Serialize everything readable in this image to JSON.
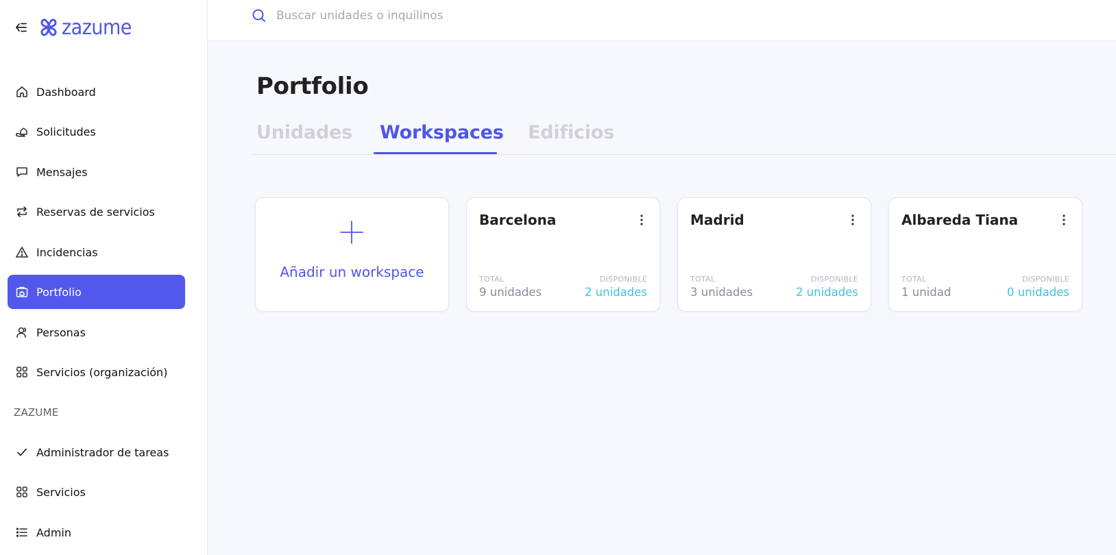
{
  "app": {
    "brand_name": "zazume",
    "brand_color": "#4f56e8",
    "accent_cyan": "#3ec3dd"
  },
  "search": {
    "placeholder": "Buscar unidades o inquilinos",
    "value": ""
  },
  "sidebar": {
    "items": [
      {
        "label": "Dashboard",
        "icon": "home-icon"
      },
      {
        "label": "Solicitudes",
        "icon": "hand-house-icon"
      },
      {
        "label": "Mensajes",
        "icon": "message-icon"
      },
      {
        "label": "Reservas de servicios",
        "icon": "repeat-icon"
      },
      {
        "label": "Incidencias",
        "icon": "warning-icon"
      },
      {
        "label": "Portfolio",
        "icon": "portfolio-icon",
        "active": true
      },
      {
        "label": "Personas",
        "icon": "people-icon"
      },
      {
        "label": "Servicios (organización)",
        "icon": "grid-icon"
      }
    ],
    "section_label": "ZAZUME",
    "section_items": [
      {
        "label": "Administrador de tareas",
        "icon": "check-icon"
      },
      {
        "label": "Servicios",
        "icon": "grid-icon"
      },
      {
        "label": "Admin",
        "icon": "list-icon"
      }
    ]
  },
  "main": {
    "title": "Portfolio",
    "tabs": [
      {
        "label": "Unidades",
        "active": false
      },
      {
        "label": "Workspaces",
        "active": true
      },
      {
        "label": "Edificios",
        "active": false
      }
    ],
    "add_card_label": "Añadir un workspace",
    "workspaces": [
      {
        "name": "Barcelona",
        "total_label": "TOTAL",
        "total_value": "9 unidades",
        "available_label": "DISPONIBLE",
        "available_value": "2 unidades"
      },
      {
        "name": "Madrid",
        "total_label": "TOTAL",
        "total_value": "3 unidades",
        "available_label": "DISPONIBLE",
        "available_value": "2 unidades"
      },
      {
        "name": "Albareda Tiana",
        "total_label": "TOTAL",
        "total_value": "1 unidad",
        "available_label": "DISPONIBLE",
        "available_value": "0 unidades"
      }
    ]
  }
}
